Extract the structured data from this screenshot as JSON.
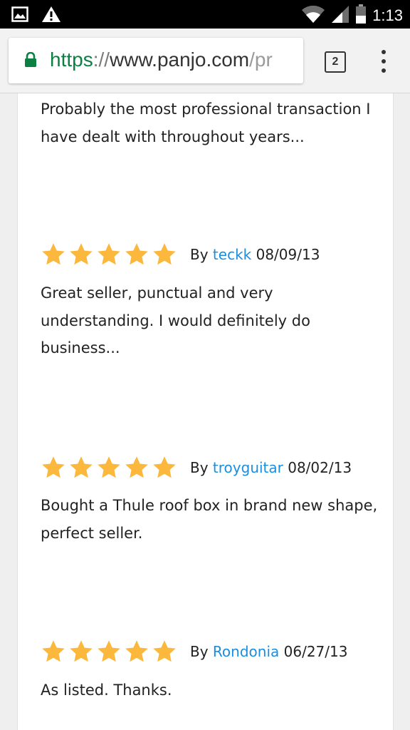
{
  "status_bar": {
    "time": "1:13",
    "icons": [
      "image-icon",
      "warning-icon",
      "wifi-icon",
      "signal-icon",
      "battery-icon"
    ]
  },
  "browser": {
    "url_scheme": "https",
    "url_separator": "://",
    "url_host": "www.panjo.com",
    "url_path": "/pr",
    "tab_count": "2",
    "icons": [
      "lock-icon",
      "overflow-menu-icon"
    ],
    "colors": {
      "secure": "#0b8043",
      "link": "#1a8ee1",
      "star": "#fbb83c"
    }
  },
  "reviews": [
    {
      "text": "Probably the most professional transaction I have dealt with throughout years..."
    },
    {
      "rating": 5,
      "by": "By",
      "author": "teckk",
      "date": "08/09/13",
      "text": "Great seller, punctual and very understanding. I would definitely do business..."
    },
    {
      "rating": 5,
      "by": "By",
      "author": "troyguitar",
      "date": "08/02/13",
      "text": "Bought a Thule roof box in brand new shape, perfect seller."
    },
    {
      "rating": 5,
      "by": "By",
      "author": "Rondonia",
      "date": "06/27/13",
      "text": "As listed. Thanks."
    }
  ]
}
